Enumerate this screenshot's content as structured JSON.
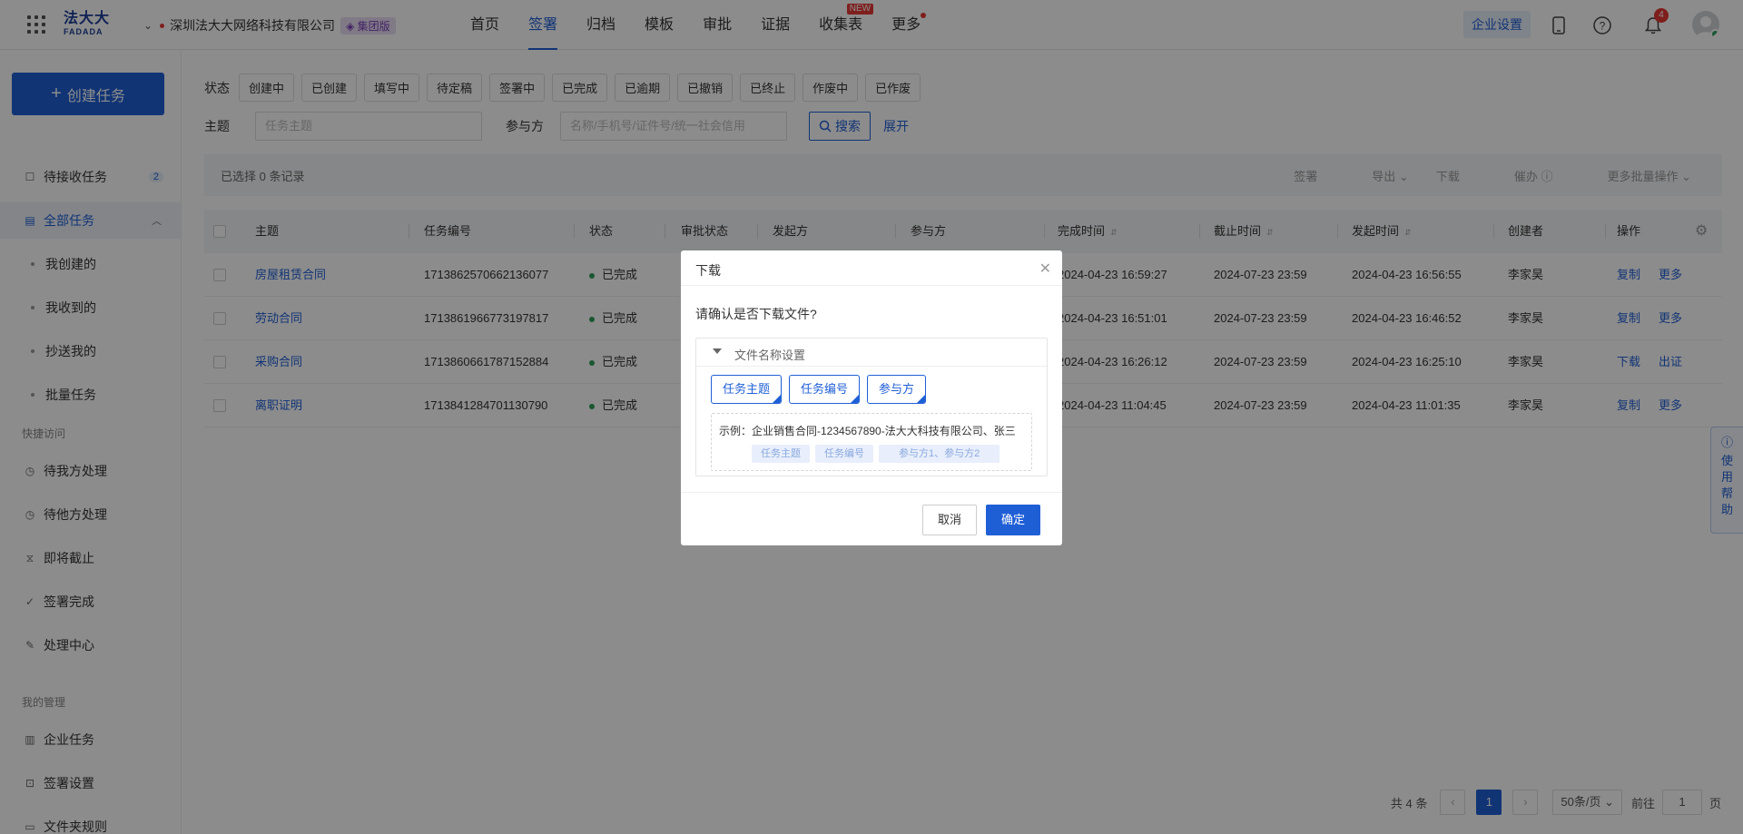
{
  "header": {
    "logo_cn": "法大大",
    "logo_en": "FADADA",
    "company": "深圳法大大网络科技有限公司",
    "company_badge": "集团版",
    "nav": [
      {
        "label": "首页",
        "active": false
      },
      {
        "label": "签署",
        "active": true
      },
      {
        "label": "归档",
        "active": false
      },
      {
        "label": "模板",
        "active": false
      },
      {
        "label": "审批",
        "active": false
      },
      {
        "label": "证据",
        "active": false
      },
      {
        "label": "收集表",
        "active": false,
        "badge": "NEW"
      },
      {
        "label": "更多",
        "active": false,
        "dot": true
      }
    ],
    "enterprise_settings": "企业设置",
    "notification_count": "4"
  },
  "sidebar": {
    "create_button": "创建任务",
    "items": [
      {
        "label": "待接收任务",
        "count": "2"
      },
      {
        "label": "全部任务"
      }
    ],
    "sub_items": [
      "我创建的",
      "我收到的",
      "抄送我的",
      "批量任务"
    ],
    "group_quick": "快捷访问",
    "quick_items": [
      "待我方处理",
      "待他方处理",
      "即将截止",
      "签署完成",
      "处理中心"
    ],
    "group_manage": "我的管理",
    "manage_items": [
      "企业任务",
      "签署设置",
      "文件夹规则"
    ]
  },
  "filters": {
    "status_label": "状态",
    "statuses": [
      "创建中",
      "已创建",
      "填写中",
      "待定稿",
      "签署中",
      "已完成",
      "已逾期",
      "已撤销",
      "已终止",
      "作废中",
      "已作废"
    ],
    "subject_label": "主题",
    "subject_placeholder": "任务主题",
    "participant_label": "参与方",
    "participant_placeholder": "名称/手机号/证件号/统一社会信用",
    "search_button": "搜索",
    "expand_link": "展开"
  },
  "action_bar": {
    "selected_text": "已选择 0 条记录",
    "actions": [
      "签署",
      "导出",
      "下载",
      "催办",
      "更多批量操作"
    ]
  },
  "table": {
    "headers": [
      "主题",
      "任务编号",
      "状态",
      "审批状态",
      "发起方",
      "参与方",
      "完成时间",
      "截止时间",
      "发起时间",
      "创建者",
      "操作"
    ],
    "rows": [
      {
        "subject": "房屋租赁合同",
        "id": "1713862570662136077",
        "status": "已完成",
        "completed": "2024-04-23 16:59:27",
        "deadline": "2024-07-23 23:59",
        "started": "2024-04-23 16:56:55",
        "creator": "李家昊",
        "op1": "复制",
        "op2": "更多"
      },
      {
        "subject": "劳动合同",
        "id": "1713861966773197817",
        "status": "已完成",
        "completed": "2024-04-23 16:51:01",
        "deadline": "2024-07-23 23:59",
        "started": "2024-04-23 16:46:52",
        "creator": "李家昊",
        "op1": "复制",
        "op2": "更多"
      },
      {
        "subject": "采购合同",
        "id": "1713860661787152884",
        "status": "已完成",
        "completed": "2024-04-23 16:26:12",
        "deadline": "2024-07-23 23:59",
        "started": "2024-04-23 16:25:10",
        "creator": "李家昊",
        "op1": "下载",
        "op2": "出证"
      },
      {
        "subject": "离职证明",
        "id": "1713841284701130790",
        "status": "已完成",
        "completed": "2024-04-23 11:04:45",
        "deadline": "2024-07-23 23:59",
        "started": "2024-04-23 11:01:35",
        "creator": "李家昊",
        "op1": "复制",
        "op2": "更多"
      }
    ]
  },
  "pagination": {
    "total": "共 4 条",
    "current": "1",
    "page_size": "50条/页",
    "goto_prefix": "前往",
    "goto_value": "1",
    "goto_suffix": "页"
  },
  "help_tab": "使用帮助",
  "dialog": {
    "title": "下载",
    "question": "请确认是否下载文件?",
    "section_title": "文件名称设置",
    "tags": [
      "任务主题",
      "任务编号",
      "参与方"
    ],
    "example_text": "示例：企业销售合同-1234567890-法大大科技有限公司、张三",
    "example_tags": [
      "任务主题",
      "任务编号",
      "参与方1、参与方2"
    ],
    "cancel": "取消",
    "confirm": "确定"
  },
  "colors": {
    "primary": "#1f5fd6",
    "status_done": "#2e9e59",
    "badge_red": "#e53935"
  }
}
